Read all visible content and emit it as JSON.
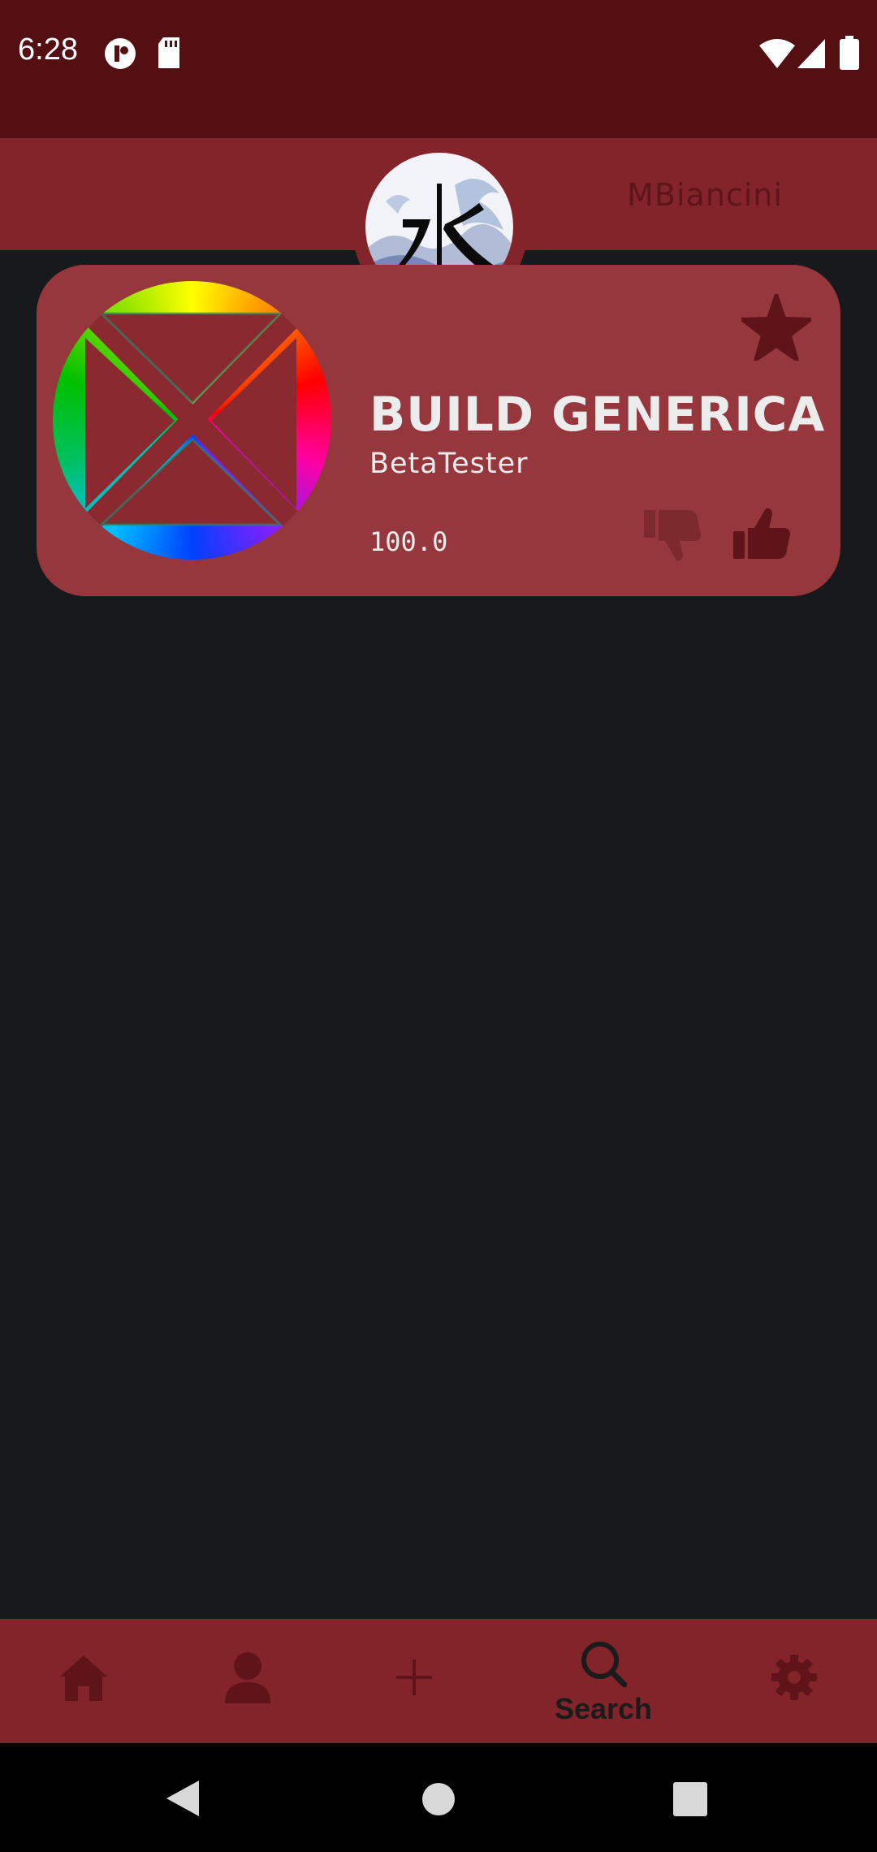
{
  "status_bar": {
    "time": "6:28",
    "icons": [
      "app-notification-icon",
      "sd-card-icon",
      "wifi-icon",
      "signal-icon",
      "battery-icon"
    ]
  },
  "header": {
    "username": "MBiancini",
    "logo": "water-kanji-wave-logo"
  },
  "build_card": {
    "title": "BUILD GENERICA",
    "author": "BetaTester",
    "score": "100.0",
    "image": "generic-build-image",
    "actions": [
      "favorite-star-icon",
      "thumbs-down-icon",
      "thumbs-up-icon"
    ]
  },
  "bottom_nav": {
    "items": [
      {
        "id": "home",
        "icon": "home-icon"
      },
      {
        "id": "profile",
        "icon": "user-icon"
      },
      {
        "id": "add",
        "icon": "plus-icon"
      },
      {
        "id": "search",
        "icon": "search-icon",
        "label": "Search",
        "active": true
      },
      {
        "id": "settings",
        "icon": "gear-icon"
      }
    ]
  },
  "system_nav": [
    "back-icon",
    "home-circle-icon",
    "recents-icon"
  ],
  "colors": {
    "status_bar": "#530f12",
    "header": "#83242b",
    "card": "#95373c",
    "background": "#18191c",
    "icon_dark": "#5e1418",
    "text_light": "#ececec"
  }
}
